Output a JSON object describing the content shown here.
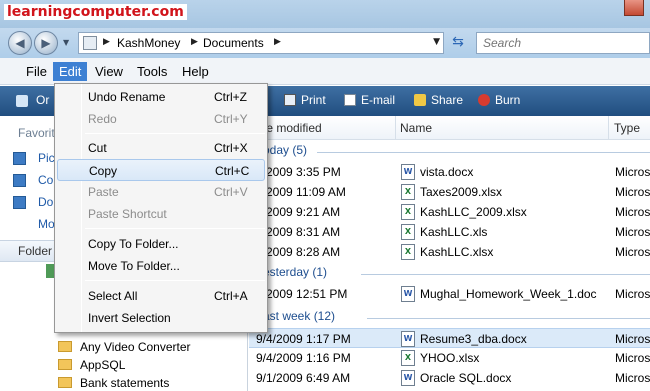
{
  "watermark": "learningcomputer.com",
  "address": {
    "crumbs": [
      "KashMoney",
      "Documents"
    ],
    "search_placeholder": "Search"
  },
  "menubar": [
    "File",
    "Edit",
    "View",
    "Tools",
    "Help"
  ],
  "toolbar": {
    "organize": "Or",
    "print": "Print",
    "email": "E-mail",
    "share": "Share",
    "burn": "Burn"
  },
  "leftpane": {
    "favorites_header": "Favorit",
    "favorites": [
      "Pic",
      "Co",
      "Do",
      "Mo"
    ],
    "folders_header": "Folder",
    "folders": [
      "Any Video Converter",
      "AppSQL",
      "Bank statements"
    ]
  },
  "columns": {
    "date": "te modified",
    "name": "Name",
    "type": "Type"
  },
  "groups": {
    "today": "oday (5)",
    "yesterday": "esterday (1)",
    "lastweek": "ast week (12)"
  },
  "files": [
    {
      "date": "5/2009 3:35 PM",
      "name": "vista.docx",
      "type": "Micros",
      "kind": "word"
    },
    {
      "date": "5/2009 11:09 AM",
      "name": "Taxes2009.xlsx",
      "type": "Micros",
      "kind": "excel"
    },
    {
      "date": "5/2009 9:21 AM",
      "name": "KashLLC_2009.xlsx",
      "type": "Micros",
      "kind": "excel"
    },
    {
      "date": "5/2009 8:31 AM",
      "name": "KashLLC.xls",
      "type": "Micros",
      "kind": "excel"
    },
    {
      "date": "5/2009 8:28 AM",
      "name": "KashLLC.xlsx",
      "type": "Micros",
      "kind": "excel"
    },
    {
      "date": "5/2009 12:51 PM",
      "name": "Mughal_Homework_Week_1.doc",
      "type": "Micros",
      "kind": "word"
    },
    {
      "date": "9/4/2009 1:17 PM",
      "name": "Resume3_dba.docx",
      "type": "Micros",
      "kind": "word"
    },
    {
      "date": "9/4/2009 1:16 PM",
      "name": "YHOO.xlsx",
      "type": "Micros",
      "kind": "excel"
    },
    {
      "date": "9/1/2009 6:49 AM",
      "name": "Oracle SQL.docx",
      "type": "Micros",
      "kind": "word"
    }
  ],
  "edit_menu": [
    {
      "label": "Undo Rename",
      "shortcut": "Ctrl+Z",
      "enabled": true
    },
    {
      "label": "Redo",
      "shortcut": "Ctrl+Y",
      "enabled": false
    },
    {
      "label": "Cut",
      "shortcut": "Ctrl+X",
      "enabled": true
    },
    {
      "label": "Copy",
      "shortcut": "Ctrl+C",
      "enabled": true,
      "highlighted": true
    },
    {
      "label": "Paste",
      "shortcut": "Ctrl+V",
      "enabled": false
    },
    {
      "label": "Paste Shortcut",
      "shortcut": "",
      "enabled": false
    },
    {
      "label": "Copy To Folder...",
      "shortcut": "",
      "enabled": true
    },
    {
      "label": "Move To Folder...",
      "shortcut": "",
      "enabled": true
    },
    {
      "label": "Select All",
      "shortcut": "Ctrl+A",
      "enabled": true
    },
    {
      "label": "Invert Selection",
      "shortcut": "",
      "enabled": true
    }
  ],
  "colors": {
    "accent": "#3d80d3",
    "toolbar": "#2a5a8e",
    "selection": "#dbeaf9"
  }
}
